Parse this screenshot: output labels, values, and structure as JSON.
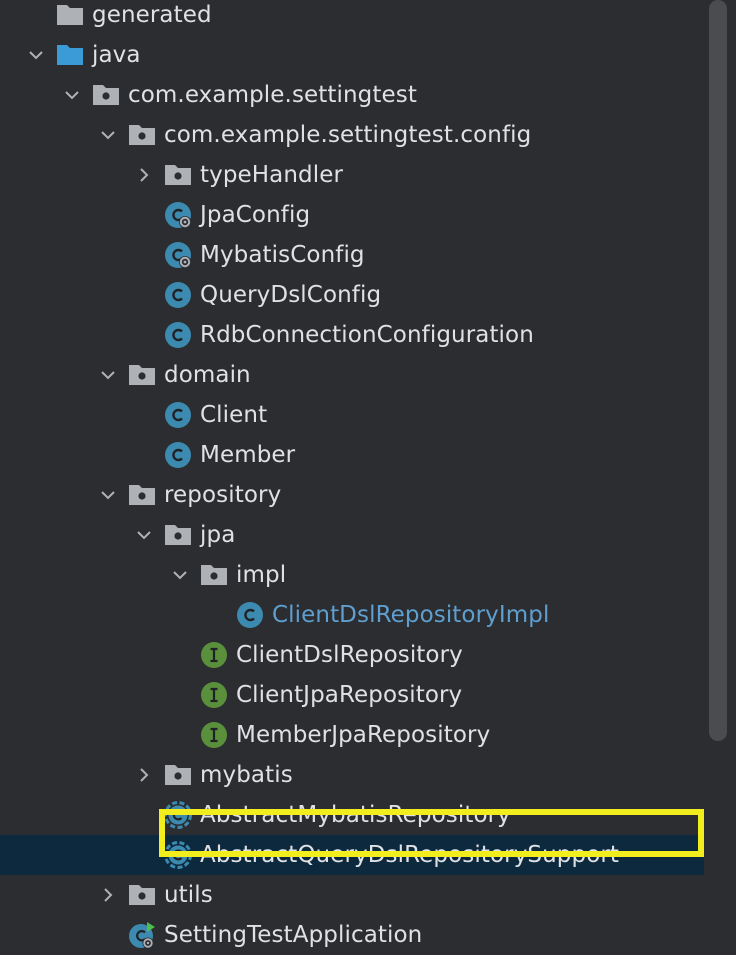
{
  "tree": {
    "rows": [
      {
        "label": "generated",
        "icon": "folder-gray-icon",
        "caret": "none",
        "depth": 1
      },
      {
        "label": "java",
        "icon": "folder-blue-icon",
        "caret": "expanded",
        "depth": 1
      },
      {
        "label": "com.example.settingtest",
        "icon": "package-icon",
        "caret": "expanded",
        "depth": 2
      },
      {
        "label": "com.example.settingtest.config",
        "icon": "package-icon",
        "caret": "expanded",
        "depth": 3
      },
      {
        "label": "typeHandler",
        "icon": "package-icon",
        "caret": "collapsed",
        "depth": 4
      },
      {
        "label": "JpaConfig",
        "icon": "config-class-icon",
        "caret": "none",
        "depth": 4
      },
      {
        "label": "MybatisConfig",
        "icon": "config-class-icon",
        "caret": "none",
        "depth": 4
      },
      {
        "label": "QueryDslConfig",
        "icon": "class-icon",
        "caret": "none",
        "depth": 4
      },
      {
        "label": "RdbConnectionConfiguration",
        "icon": "class-icon",
        "caret": "none",
        "depth": 4
      },
      {
        "label": "domain",
        "icon": "package-icon",
        "caret": "expanded",
        "depth": 3
      },
      {
        "label": "Client",
        "icon": "class-icon",
        "caret": "none",
        "depth": 4
      },
      {
        "label": "Member",
        "icon": "class-icon",
        "caret": "none",
        "depth": 4
      },
      {
        "label": "repository",
        "icon": "package-icon",
        "caret": "expanded",
        "depth": 3
      },
      {
        "label": "jpa",
        "icon": "package-icon",
        "caret": "expanded",
        "depth": 4
      },
      {
        "label": "impl",
        "icon": "package-icon",
        "caret": "expanded",
        "depth": 5
      },
      {
        "label": "ClientDslRepositoryImpl",
        "icon": "class-icon",
        "caret": "none",
        "depth": 6,
        "modified": true
      },
      {
        "label": "ClientDslRepository",
        "icon": "interface-icon",
        "caret": "none",
        "depth": 5
      },
      {
        "label": "ClientJpaRepository",
        "icon": "interface-icon",
        "caret": "none",
        "depth": 5
      },
      {
        "label": "MemberJpaRepository",
        "icon": "interface-icon",
        "caret": "none",
        "depth": 5
      },
      {
        "label": "mybatis",
        "icon": "package-icon",
        "caret": "collapsed",
        "depth": 4
      },
      {
        "label": "AbstractMybatisRepository",
        "icon": "abstract-class-icon",
        "caret": "none",
        "depth": 4
      },
      {
        "label": "AbstractQueryDslRepositorySupport",
        "icon": "abstract-class-icon",
        "caret": "none",
        "depth": 4,
        "selected": true
      },
      {
        "label": "utils",
        "icon": "package-icon",
        "caret": "collapsed",
        "depth": 3
      },
      {
        "label": "SettingTestApplication",
        "icon": "spring-app-class-icon",
        "caret": "none",
        "depth": 3
      }
    ]
  },
  "colors": {
    "background": "#2b2d30",
    "selection": "#0d293e",
    "highlight": "#f2ed1d",
    "class_icon": "#3d8ab0",
    "interface_icon": "#5a8f3c",
    "folder_gray": "#aeb1b5",
    "folder_blue": "#3a9bd6",
    "modified_text": "#5f9fd0"
  }
}
